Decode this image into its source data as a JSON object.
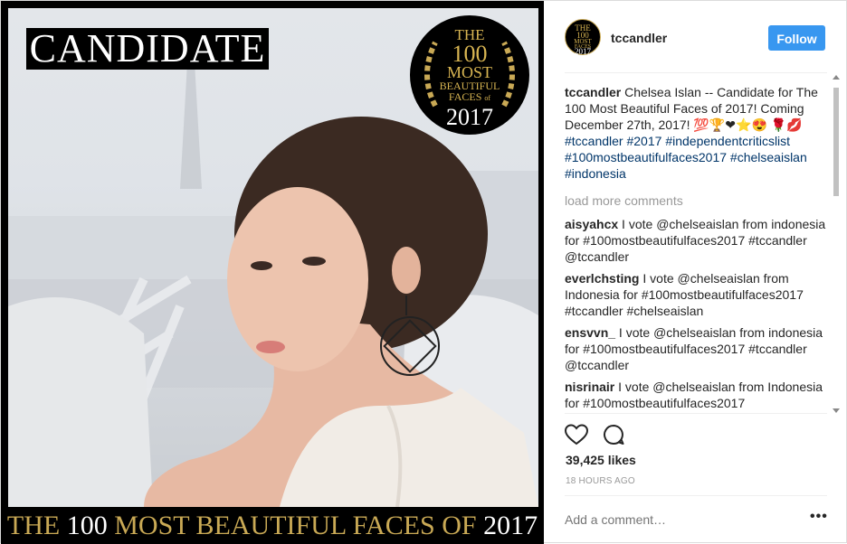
{
  "photo": {
    "top_label": "CANDIDATE",
    "badge": {
      "line1": "THE",
      "line2": "100",
      "line3": "MOST",
      "line4": "BEAUTIFUL",
      "line5": "FACES",
      "line6": "of",
      "year": "2017"
    },
    "bottom_pre": "THE",
    "bottom_num": "100",
    "bottom_mid": "MOST BEAUTIFUL FACES OF",
    "bottom_year": "2017"
  },
  "header": {
    "avatar_line1": "THE",
    "avatar_line2": "100",
    "avatar_line3": "MOST",
    "avatar_line4": "FACES",
    "avatar_line5": "2017",
    "username": "tccandler",
    "follow_label": "Follow"
  },
  "caption": {
    "username": "tccandler",
    "text": " Chelsea Islan -- Candidate for The 100 Most Beautiful Faces of 2017! Coming December 27th, 2017! 💯🏆❤⭐😍 🌹💋",
    "tags": [
      "#tccandler",
      "#2017",
      "#independentcriticslist",
      "#100mostbeautifulfaces2017",
      "#chelseaislan",
      "#indonesia"
    ]
  },
  "load_more": "load more comments",
  "comments": [
    {
      "user": "aisyahcx",
      "text": " I vote @chelseaislan from indonesia for #100mostbeautifulfaces2017 #tccandler @tccandler"
    },
    {
      "user": "everlchsting",
      "text": " I vote @chelseaislan from Indonesia for #100mostbeautifulfaces2017 #tccandler #chelseaislan"
    },
    {
      "user": "ensvvn_",
      "text": " I vote @chelseaislan from indonesia for #100mostbeautifulfaces2017 #tccandler @tccandler"
    },
    {
      "user": "nisrinair",
      "text": " I vote @chelseaislan from Indonesia for #100mostbeautifulfaces2017"
    }
  ],
  "likes": "39,425 likes",
  "time_ago": "18 HOURS AGO",
  "add_comment_placeholder": "Add a comment…",
  "more_label": "•••",
  "colors": {
    "follow": "#3897f0",
    "hashtag": "#003569",
    "gold": "#c9a955"
  }
}
